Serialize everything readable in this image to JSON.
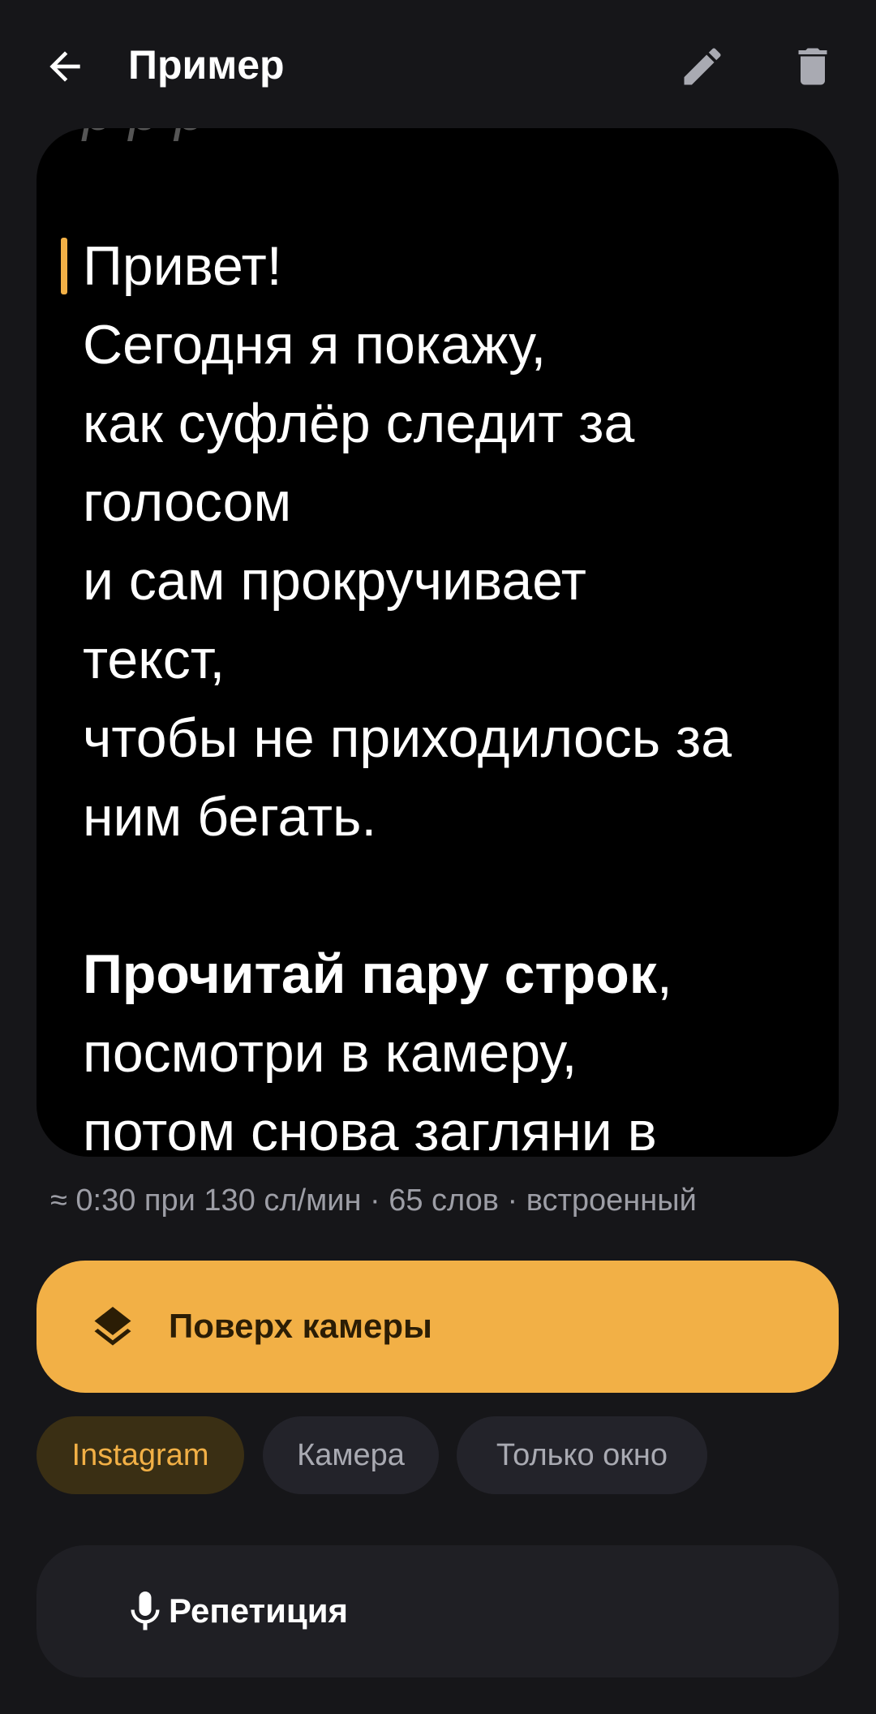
{
  "header": {
    "title": "Пример",
    "back_icon": "arrow-left-icon",
    "edit_icon": "pencil-icon",
    "delete_icon": "trash-icon"
  },
  "script": {
    "faded_line": "р     р   р",
    "lines": [
      "Привет!",
      "Сегодня я покажу,",
      "как суфлёр следит за",
      "голосом",
      "и сам прокручивает",
      "текст,",
      "чтобы не приходилось за",
      "ним бегать."
    ],
    "bold_phrase": "Прочитай пару строк",
    "bold_suffix": ",",
    "lines_after": [
      "посмотри в камеру,",
      "потом снова загляни в"
    ]
  },
  "stats": "≈ 0:30 при 130 сл/мин · 65 слов · встроенный",
  "overlay_button": {
    "label": "Поверх камеры",
    "icon": "layers-icon"
  },
  "modes": [
    {
      "label": "Instagram",
      "active": true
    },
    {
      "label": "Камера",
      "active": false
    },
    {
      "label": "Только окно",
      "active": false
    }
  ],
  "rehearsal_button": {
    "label": "Репетиция",
    "icon": "microphone-icon"
  },
  "colors": {
    "background": "#161619",
    "card": "#000000",
    "accent": "#f2b046",
    "chip": "#23232a",
    "chip_active": "#3a2f14",
    "muted_text": "#9d9ea6"
  }
}
